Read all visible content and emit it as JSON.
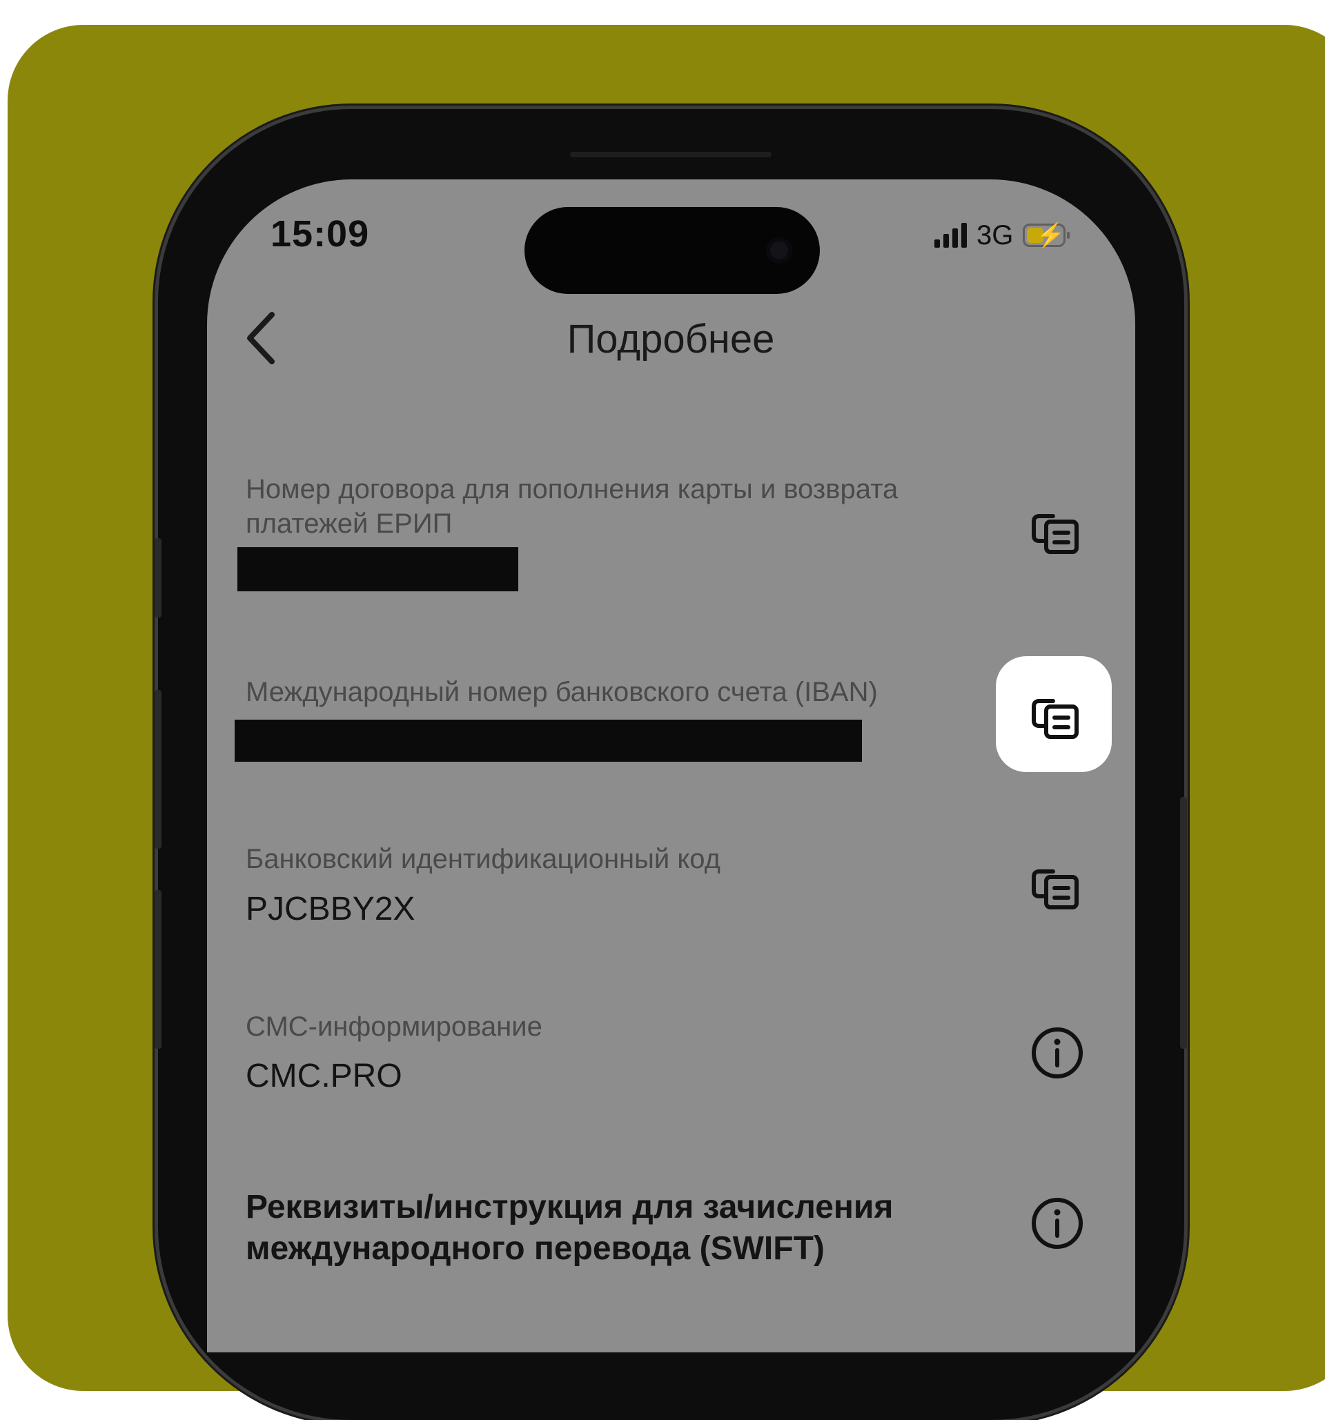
{
  "status_bar": {
    "time": "15:09",
    "network": "3G"
  },
  "header": {
    "title": "Подробнее"
  },
  "rows": [
    {
      "label": "Номер договора для пополнения карты и возврата платежей ЕРИП",
      "value_redacted": true,
      "action_icon": "copy-icon"
    },
    {
      "label": "Международный номер банковского счета (IBAN)",
      "value_redacted": true,
      "action_icon": "copy-icon",
      "highlighted": true
    },
    {
      "label": "Банковский идентификационный код",
      "value": "PJCBBY2X",
      "action_icon": "copy-icon"
    },
    {
      "label": "СМС-информирование",
      "value": "CMC.PRO",
      "action_icon": "info-icon"
    },
    {
      "label": "Реквизиты/инструкция для зачисления международного перевода (SWIFT)",
      "action_icon": "info-icon"
    }
  ],
  "colors": {
    "background": "#8b870b",
    "screen_dimmed": "#8d8d8d",
    "highlight": "#ffffff",
    "redaction": "#0b0b0b"
  }
}
